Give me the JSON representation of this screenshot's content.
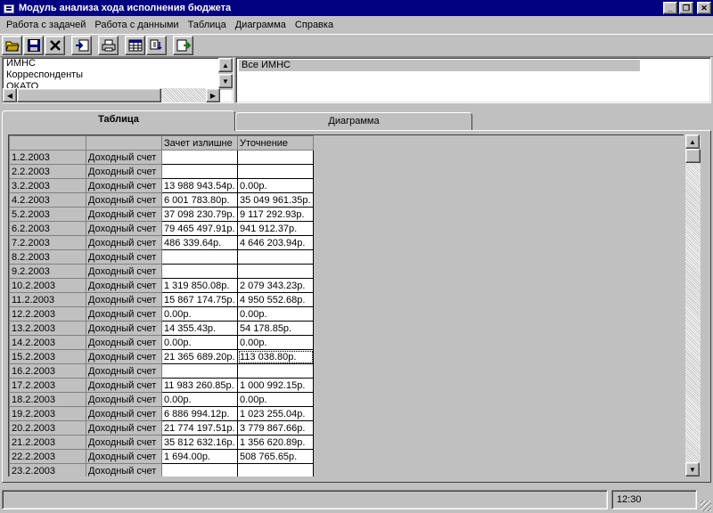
{
  "window": {
    "title": "Модуль анализа хода исполнения бюджета",
    "min_glyph": "_",
    "max_glyph": "❐",
    "close_glyph": "✕"
  },
  "menu": [
    "Работа с задачей",
    "Работа с данными",
    "Таблица",
    "Диаграмма",
    "Справка"
  ],
  "toolbar": {
    "icons": [
      "open-folder-icon",
      "save-icon",
      "delete-icon",
      "import-icon",
      "print-icon",
      "table-view-icon",
      "data-refresh-icon",
      "export-icon"
    ]
  },
  "listbox": {
    "items": [
      "ИМНС",
      "Корреспонденты",
      "ОКАТО"
    ]
  },
  "right_panel": {
    "selected": "Все ИМНС"
  },
  "tabs": {
    "table": "Таблица",
    "chart": "Диаграмма"
  },
  "grid": {
    "headers": [
      "",
      "",
      "Зачет излишне",
      "Уточнение"
    ],
    "rows": [
      [
        "1.2.2003",
        "Доходный счет",
        "",
        ""
      ],
      [
        "2.2.2003",
        "Доходный счет",
        "",
        ""
      ],
      [
        "3.2.2003",
        "Доходный счет",
        "13 988 943.54р.",
        "0.00р."
      ],
      [
        "4.2.2003",
        "Доходный счет",
        "6 001 783.80р.",
        "35 049 961.35р."
      ],
      [
        "5.2.2003",
        "Доходный счет",
        "37 098 230.79р.",
        "9 117 292.93р."
      ],
      [
        "6.2.2003",
        "Доходный счет",
        "79 465 497.91р.",
        "941 912.37р."
      ],
      [
        "7.2.2003",
        "Доходный счет",
        "486 339.64р.",
        "4 646 203.94р."
      ],
      [
        "8.2.2003",
        "Доходный счет",
        "",
        ""
      ],
      [
        "9.2.2003",
        "Доходный счет",
        "",
        ""
      ],
      [
        "10.2.2003",
        "Доходный счет",
        "1 319 850.08р.",
        "2 079 343.23р."
      ],
      [
        "11.2.2003",
        "Доходный счет",
        "15 867 174.75р.",
        "4 950 552.68р."
      ],
      [
        "12.2.2003",
        "Доходный счет",
        "0.00р.",
        "0.00р."
      ],
      [
        "13.2.2003",
        "Доходный счет",
        "14 355.43р.",
        "54 178.85р."
      ],
      [
        "14.2.2003",
        "Доходный счет",
        "0.00р.",
        "0.00р."
      ],
      [
        "15.2.2003",
        "Доходный счет",
        "21 365 689.20р.",
        "113 038.80р."
      ],
      [
        "16.2.2003",
        "Доходный счет",
        "",
        ""
      ],
      [
        "17.2.2003",
        "Доходный счет",
        "11 983 260.85р.",
        "1 000 992.15р."
      ],
      [
        "18.2.2003",
        "Доходный счет",
        "0.00р.",
        "0.00р."
      ],
      [
        "19.2.2003",
        "Доходный счет",
        "6 886 994.12р.",
        "1 023 255.04р."
      ],
      [
        "20.2.2003",
        "Доходный счет",
        "21 774 197.51р.",
        "3 779 867.66р."
      ],
      [
        "21.2.2003",
        "Доходный счет",
        "35 812 632.16р.",
        "1 356 620.89р."
      ],
      [
        "22.2.2003",
        "Доходный счет",
        "1 694.00р.",
        "508 765.65р."
      ],
      [
        "23.2.2003",
        "Доходный счет",
        "",
        ""
      ]
    ],
    "focus_row": 14,
    "focus_col": 3
  },
  "status": {
    "message": "",
    "time": "12:30"
  }
}
